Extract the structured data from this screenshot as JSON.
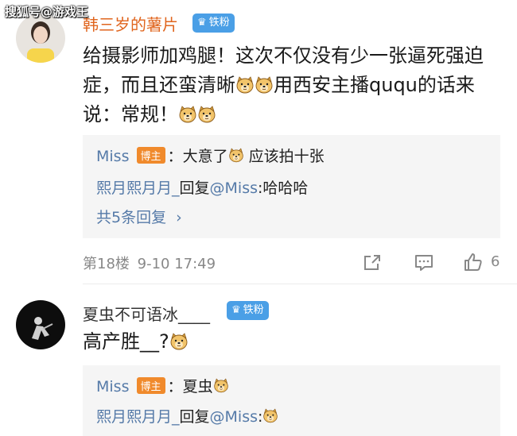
{
  "watermark": "搜狐号@游戏王",
  "comments": [
    {
      "username": "韩三岁的薯片",
      "badge": "铁粉",
      "content_parts": [
        "给摄影师加鸡腿！这次不仅没有少一张逼死强迫",
        "症，而且还蛮清晰",
        "用西安主播ququ的话来",
        "说：常规！"
      ],
      "replies": [
        {
          "author": "Miss",
          "tag": "博主",
          "sep": "：",
          "text": "大意了",
          "text2": " 应该拍十张"
        },
        {
          "author": "熙月熙月月_",
          "mid": "回复",
          "mention": "@Miss",
          "sep": ":",
          "text": "哈哈哈"
        }
      ],
      "more_replies": "共5条回复",
      "floor": "第18楼",
      "time": "9-10 17:49",
      "likes": "6"
    },
    {
      "username": "夏虫不可语冰____",
      "badge": "铁粉",
      "content": "高产胜__?",
      "replies": [
        {
          "author": "Miss",
          "tag": "博主",
          "sep": "：",
          "text": "夏虫"
        },
        {
          "author": "熙月熙月月_",
          "mid": "回复",
          "mention": "@Miss",
          "sep": ":"
        }
      ]
    }
  ],
  "colors": {
    "link_blue": "#557aa8",
    "badge_blue": "#4a9fe6",
    "host_orange": "#f08a2c",
    "username_orange": "#e0651e"
  },
  "icons": [
    "crown-icon",
    "share-icon",
    "comment-icon",
    "like-icon",
    "doge-emoji"
  ]
}
